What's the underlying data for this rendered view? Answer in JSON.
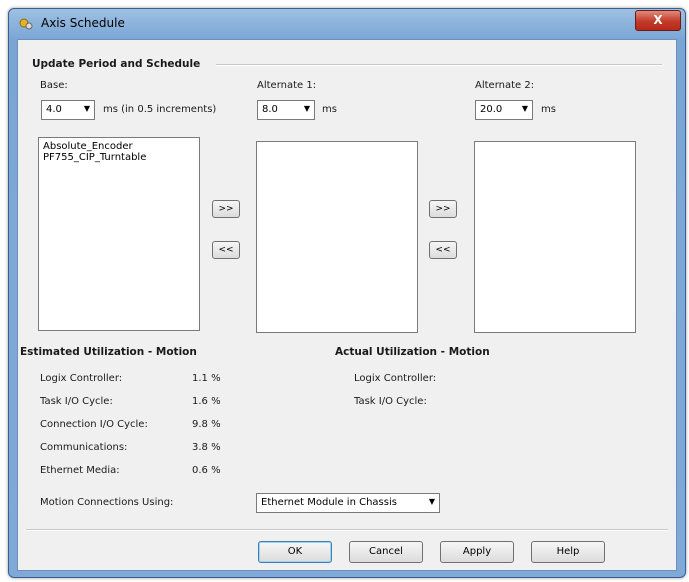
{
  "window": {
    "title": "Axis Schedule",
    "close_label": "X"
  },
  "schedule": {
    "section_title": "Update Period and Schedule",
    "base": {
      "label": "Base:",
      "value": "4.0",
      "unit": "ms (in 0.5 increments)",
      "items": [
        "Absolute_Encoder",
        "PF755_CIP_Turntable"
      ]
    },
    "alt1": {
      "label": "Alternate 1:",
      "value": "8.0",
      "unit": "ms"
    },
    "alt2": {
      "label": "Alternate 2:",
      "value": "20.0",
      "unit": "ms"
    },
    "move_right": ">>",
    "move_left": "<<"
  },
  "estimated": {
    "title": "Estimated Utilization - Motion",
    "rows": [
      {
        "label": "Logix Controller:",
        "value": "1.1 %"
      },
      {
        "label": "Task I/O Cycle:",
        "value": "1.6 %"
      },
      {
        "label": "Connection I/O Cycle:",
        "value": "9.8 %"
      },
      {
        "label": "Communications:",
        "value": "3.8 %"
      },
      {
        "label": "Ethernet Media:",
        "value": "0.6 %"
      }
    ]
  },
  "actual": {
    "title": "Actual Utilization - Motion",
    "rows": [
      {
        "label": "Logix Controller:"
      },
      {
        "label": "Task I/O Cycle:"
      }
    ]
  },
  "connections": {
    "label": "Motion Connections Using:",
    "value": "Ethernet Module in Chassis"
  },
  "buttons": {
    "ok": "OK",
    "cancel": "Cancel",
    "apply": "Apply",
    "help": "Help"
  }
}
